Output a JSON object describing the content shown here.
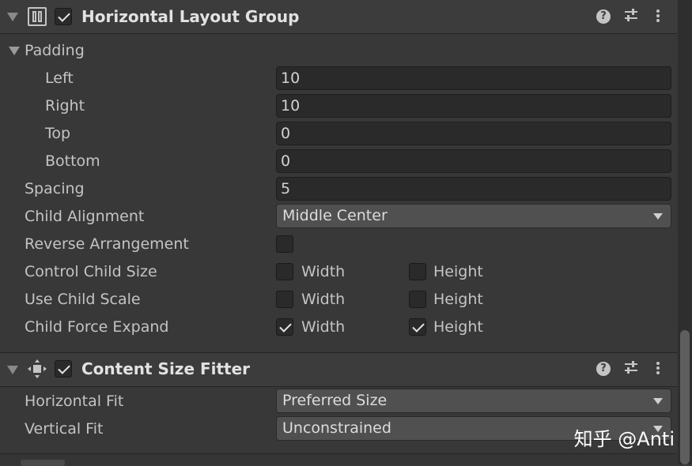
{
  "horizontal_layout_group": {
    "title": "Horizontal Layout Group",
    "enabled": true,
    "padding_label": "Padding",
    "padding": [
      {
        "label": "Left",
        "value": "10"
      },
      {
        "label": "Right",
        "value": "10"
      },
      {
        "label": "Top",
        "value": "0"
      },
      {
        "label": "Bottom",
        "value": "0"
      }
    ],
    "spacing": {
      "label": "Spacing",
      "value": "5"
    },
    "child_alignment": {
      "label": "Child Alignment",
      "value": "Middle Center"
    },
    "reverse_arrangement": {
      "label": "Reverse Arrangement",
      "checked": false
    },
    "control_child_size": {
      "label": "Control Child Size",
      "width_label": "Width",
      "height_label": "Height",
      "width": false,
      "height": false
    },
    "use_child_scale": {
      "label": "Use Child Scale",
      "width_label": "Width",
      "height_label": "Height",
      "width": false,
      "height": false
    },
    "child_force_expand": {
      "label": "Child Force Expand",
      "width_label": "Width",
      "height_label": "Height",
      "width": true,
      "height": true
    }
  },
  "content_size_fitter": {
    "title": "Content Size Fitter",
    "enabled": true,
    "horizontal_fit": {
      "label": "Horizontal Fit",
      "value": "Preferred Size"
    },
    "vertical_fit": {
      "label": "Vertical Fit",
      "value": "Unconstrained"
    }
  },
  "header_icons": [
    "help-icon",
    "preset-sliders-icon",
    "kebab-menu-icon"
  ],
  "watermark": "知乎 @Anti",
  "colors": {
    "background": "#383838",
    "header": "#3c3c3c",
    "field": "#2a2a2a",
    "dropdown": "#505050",
    "text": "#c4c4c4"
  }
}
